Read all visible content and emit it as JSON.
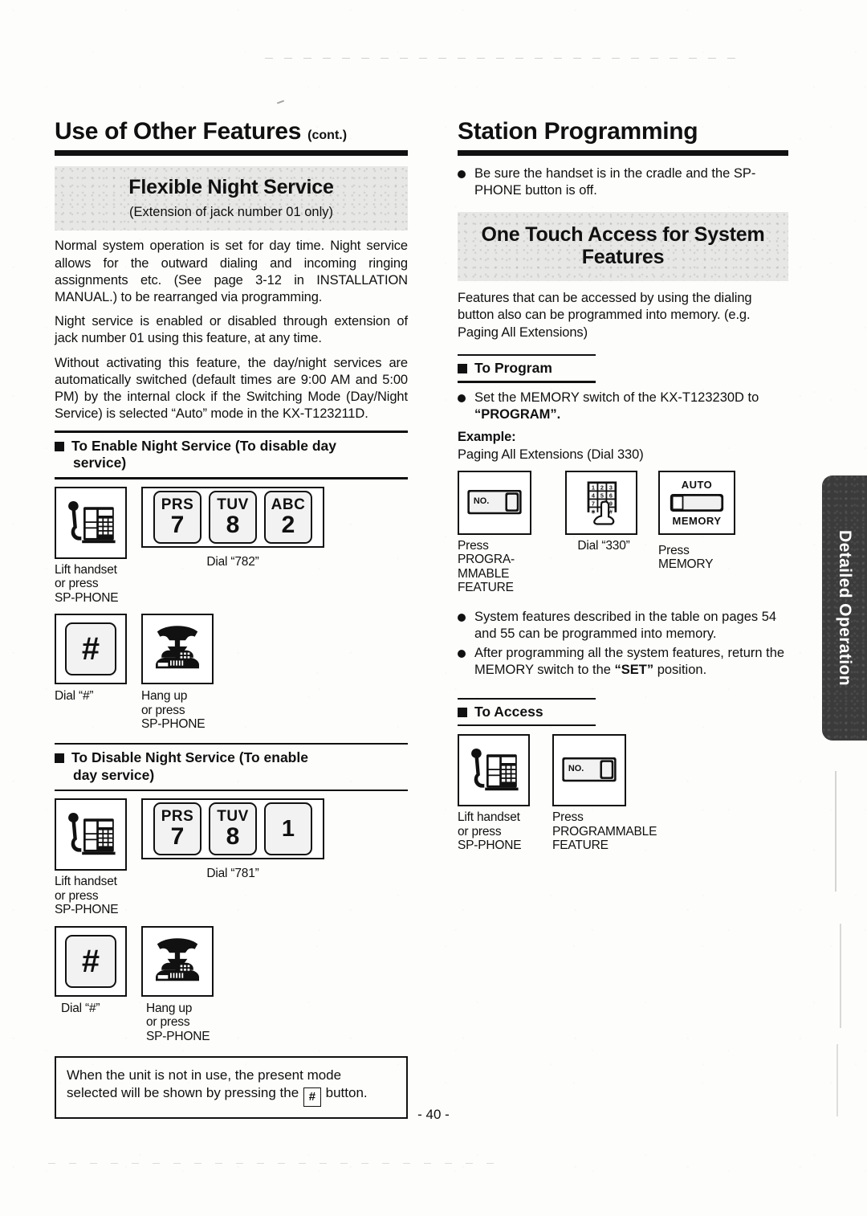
{
  "page": {
    "number": "- 40 -",
    "side_tab": "Detailed Operation"
  },
  "left": {
    "heading": "Use of Other Features",
    "heading_suffix": "(cont.)",
    "band": {
      "title": "Flexible Night Service",
      "subtitle": "(Extension of  jack number 01 only)"
    },
    "paragraphs": [
      "Normal system operation is set for day time. Night service allows for the outward dialing and incoming ringing assignments etc. (See page 3-12 in INSTALLATION MANUAL.) to be rearranged via programming.",
      "Night service is enabled or disabled through extension of jack number 01 using this feature, at any time.",
      "Without activating this feature, the day/night services are automatically switched (default times are 9:00 AM and 5:00 PM) by the internal clock if the Switching Mode (Day/Night Service) is selected “Auto” mode in the KX-T123211D."
    ],
    "enable": {
      "subhead_line1": "To Enable Night Service (To disable day",
      "subhead_line2": "service)",
      "step1_caption": "Lift handset\nor press\nSP-PHONE",
      "keys": [
        {
          "letters": "PRS",
          "number": "7"
        },
        {
          "letters": "TUV",
          "number": "8"
        },
        {
          "letters": "ABC",
          "number": "2"
        }
      ],
      "dial_caption": "Dial “782”",
      "hash_caption": "Dial “#”",
      "hash_glyph": "#",
      "hangup_caption": "Hang up\nor press\nSP-PHONE"
    },
    "disable": {
      "subhead_line1": "To Disable Night Service (To enable",
      "subhead_line2": "day service)",
      "step1_caption": "Lift handset\nor press\nSP-PHONE",
      "keys": [
        {
          "letters": "PRS",
          "number": "7"
        },
        {
          "letters": "TUV",
          "number": "8"
        },
        {
          "letters": "",
          "number": "1"
        }
      ],
      "dial_caption": "Dial “781”",
      "hash_caption": "Dial “#”",
      "hash_glyph": "#",
      "hangup_caption": "Hang up\nor press\nSP-PHONE"
    },
    "note": {
      "part1": "When the unit is not in use, the present mode selected will be shown by pressing the",
      "key": "#",
      "part2": "button."
    }
  },
  "right": {
    "heading": "Station Programming",
    "intro_bullet": "Be sure the handset is in the cradle and the SP-PHONE button is off.",
    "band": {
      "title_line1": "One Touch Access for System",
      "title_line2": "Features"
    },
    "intro_paragraph": "Features that can be accessed by using the dialing button also can be programmed into memory. (e.g. Paging All Extensions)",
    "to_program": {
      "subhead": "To Program",
      "bullet_plain": "Set the MEMORY switch of the KX-T123230D to ",
      "bullet_bold": "“PROGRAM”.",
      "example_label": "Example:",
      "example_text": "Paging All Extensions (Dial 330)",
      "step1_label": "NO.",
      "step1_caption": "Press\nPROGRA-\nMMABLE FEATURE",
      "step2_caption": "Dial “330”",
      "keypad_rows": [
        [
          "1",
          "2",
          "3"
        ],
        [
          "4",
          "5",
          "6"
        ],
        [
          "7",
          "8",
          "9"
        ],
        [
          "∗",
          "0",
          "#"
        ]
      ],
      "step3_top": "AUTO",
      "step3_bottom": "MEMORY",
      "step3_caption": "Press\nMEMORY",
      "bullets": [
        "System features described in the table on pages 54 and 55 can be programmed into memory.",
        "After programming all the system features, return the MEMORY switch to the “SET” position."
      ],
      "bullet2_plain_a": "After programming all the system features, return the MEMORY switch to the ",
      "bullet2_bold": "“SET”",
      "bullet2_plain_b": " position."
    },
    "to_access": {
      "subhead": "To Access",
      "step1_caption": "Lift handset\nor press\nSP-PHONE",
      "step2_label": "NO.",
      "step2_caption": "Press\nPROGRAMMABLE\nFEATURE"
    }
  }
}
